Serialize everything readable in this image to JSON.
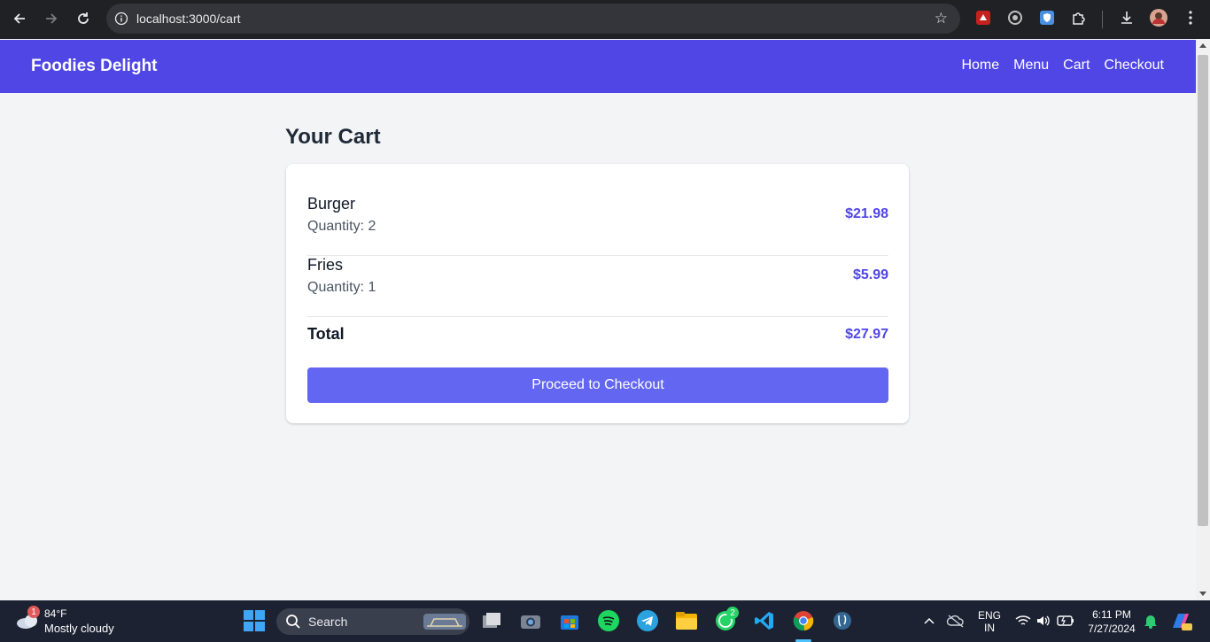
{
  "browser": {
    "url": "localhost:3000/cart"
  },
  "app": {
    "brand": "Foodies Delight",
    "nav": [
      "Home",
      "Menu",
      "Cart",
      "Checkout"
    ]
  },
  "cart": {
    "title": "Your Cart",
    "items": [
      {
        "name": "Burger",
        "quantity": "Quantity: 2",
        "price": "$21.98"
      },
      {
        "name": "Fries",
        "quantity": "Quantity: 1",
        "price": "$5.99"
      }
    ],
    "total_label": "Total",
    "total_value": "$27.97",
    "checkout_label": "Proceed to Checkout"
  },
  "colors": {
    "header": "#4f46e5",
    "accent": "#4f46e5",
    "button": "#6366f1",
    "background": "#f3f4f6"
  },
  "taskbar": {
    "weather_temp": "84°F",
    "weather_desc": "Mostly cloudy",
    "weather_badge": "1",
    "search_label": "Search",
    "whatsapp_badge": "2",
    "lang_top": "ENG",
    "lang_bottom": "IN",
    "time": "6:11 PM",
    "date": "7/27/2024"
  }
}
